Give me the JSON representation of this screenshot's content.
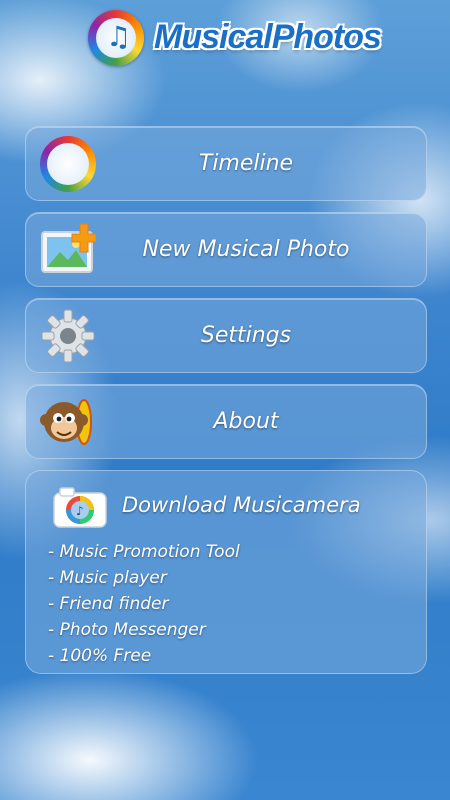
{
  "app": {
    "logo_text": "MusicalPhotos"
  },
  "menu": {
    "timeline": {
      "label": "Timeline",
      "icon": "music-disc-icon"
    },
    "new_photo": {
      "label": "New Musical Photo",
      "icon": "add-photo-icon"
    },
    "settings": {
      "label": "Settings",
      "icon": "gear-icon"
    },
    "about": {
      "label": "About",
      "icon": "monkey-guitar-icon"
    }
  },
  "download": {
    "title": "Download Musicamera",
    "icon": "musicamera-camera-icon",
    "features": [
      "- Music Promotion Tool",
      "- Music player",
      "- Friend finder",
      "- Photo Messenger",
      "- 100% Free"
    ]
  },
  "colors": {
    "sky": "#3f86cf",
    "logo_blue": "#1b6fc7",
    "button_fill": "rgba(120,170,220,0.55)"
  }
}
